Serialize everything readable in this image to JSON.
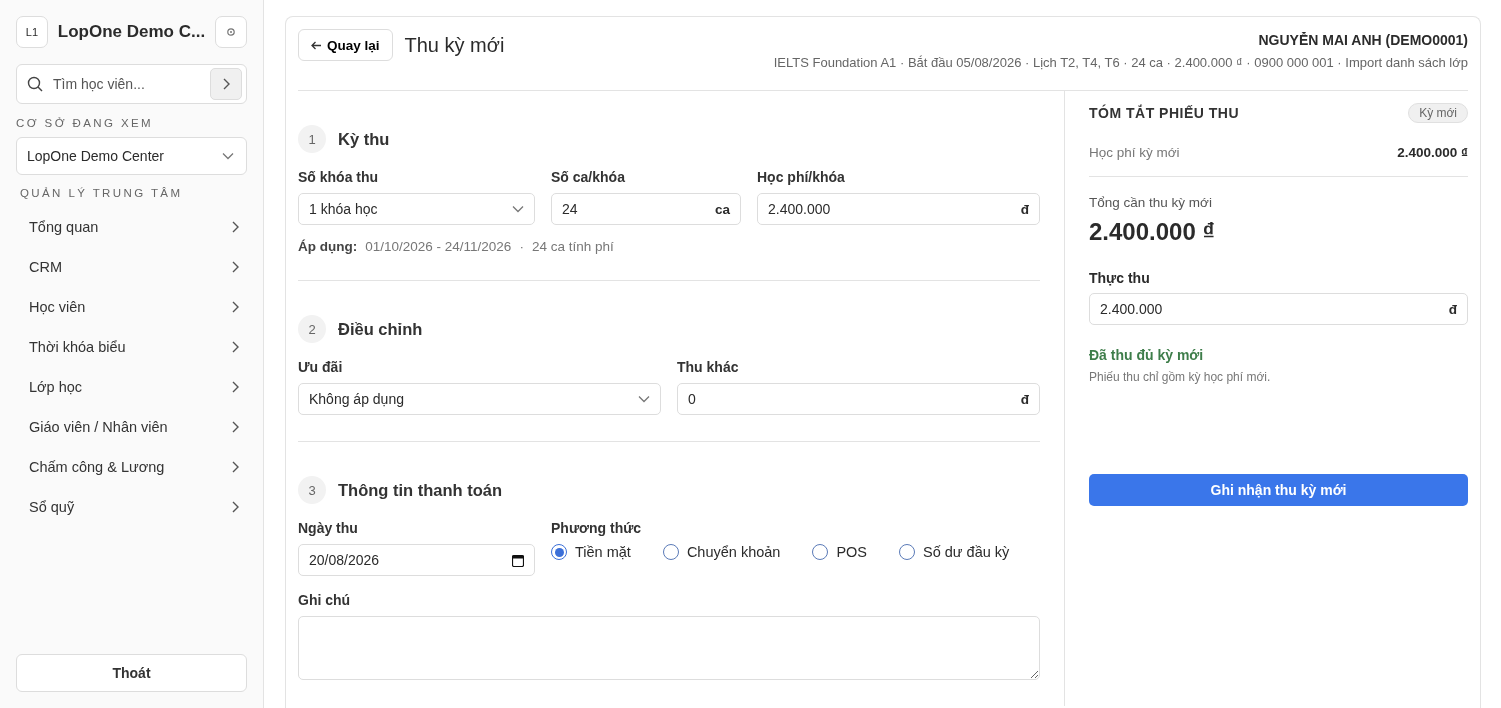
{
  "sidebar": {
    "logo": "L1",
    "title": "LopOne Demo C...",
    "search": {
      "placeholder": "Tìm học viên..."
    },
    "branch_label": "CƠ SỞ ĐANG XEM",
    "branch_select": {
      "value": "LopOne Demo Center"
    },
    "section_label": "QUẢN LÝ TRUNG TÂM",
    "nav_items": [
      {
        "label": "Tổng quan"
      },
      {
        "label": "CRM"
      },
      {
        "label": "Học viên"
      },
      {
        "label": "Thời khóa biểu"
      },
      {
        "label": "Lớp học"
      },
      {
        "label": "Giáo viên / Nhân viên"
      },
      {
        "label": "Chấm công & Lương"
      },
      {
        "label": "Sổ quỹ"
      }
    ],
    "logout": "Thoát"
  },
  "header": {
    "back_button": "Quay lại",
    "title": "Thu kỳ mới",
    "student_name": "NGUYỄN MAI ANH (DEMO0001)",
    "student_meta": "IELTS Foundation A1 · Bắt đầu 05/08/2026 · Lịch T2, T4, T6 · 24 ca · 2.400.000 ₫ · 0900 000 001 · Import danh sách lớp"
  },
  "sections": [
    {
      "number": "1",
      "title": "Kỳ thu",
      "fields": [
        {
          "kind": "select",
          "label": "Số khóa thu",
          "value": "1 khóa học"
        },
        {
          "kind": "input",
          "label": "Số ca/khóa",
          "value": "24",
          "unit": "ca"
        },
        {
          "kind": "input",
          "label": "Học phí/khóa",
          "value": "2.400.000",
          "unit": "đ"
        }
      ],
      "note": {
        "label": "Áp dụng:",
        "range": "01/10/2026 - 24/11/2026",
        "separator": "·",
        "sessions": "24 ca tính phí"
      }
    },
    {
      "number": "2",
      "title": "Điều chỉnh",
      "fields": [
        {
          "kind": "select",
          "label": "Ưu đãi",
          "value": "Không áp dụng"
        },
        {
          "kind": "input",
          "label": "Thu khác",
          "value": "0",
          "unit": "đ"
        }
      ]
    },
    {
      "number": "3",
      "title": "Thông tin thanh toán",
      "fields": [
        {
          "kind": "date",
          "label": "Ngày thu",
          "value": "20/08/2026"
        },
        {
          "kind": "radio_group",
          "label": "Phương thức",
          "options": [
            {
              "label": "Tiền mặt",
              "selected": true
            },
            {
              "label": "Chuyển khoản",
              "selected": false
            },
            {
              "label": "POS",
              "selected": false
            },
            {
              "label": "Số dư đầu kỳ",
              "selected": false
            }
          ]
        },
        {
          "kind": "textarea",
          "label": "Ghi chú"
        }
      ]
    }
  ],
  "summary": {
    "title": "TÓM TẮT PHIẾU THU",
    "badge": "Kỳ mới",
    "line_items": [
      {
        "label": "Học phí kỳ mới",
        "value": "2.400.000 ₫"
      }
    ],
    "total_label": "Tổng cần thu kỳ mới",
    "total_value": "2.400.000 ₫",
    "paid_label": "Thực thu",
    "paid_field": {
      "value": "2.400.000",
      "unit": "đ"
    },
    "status": "Đã thu đủ kỳ mới",
    "status_note": "Phiếu thu chỉ gồm kỳ học phí mới.",
    "submit_button": "Ghi nhận thu kỳ mới"
  }
}
